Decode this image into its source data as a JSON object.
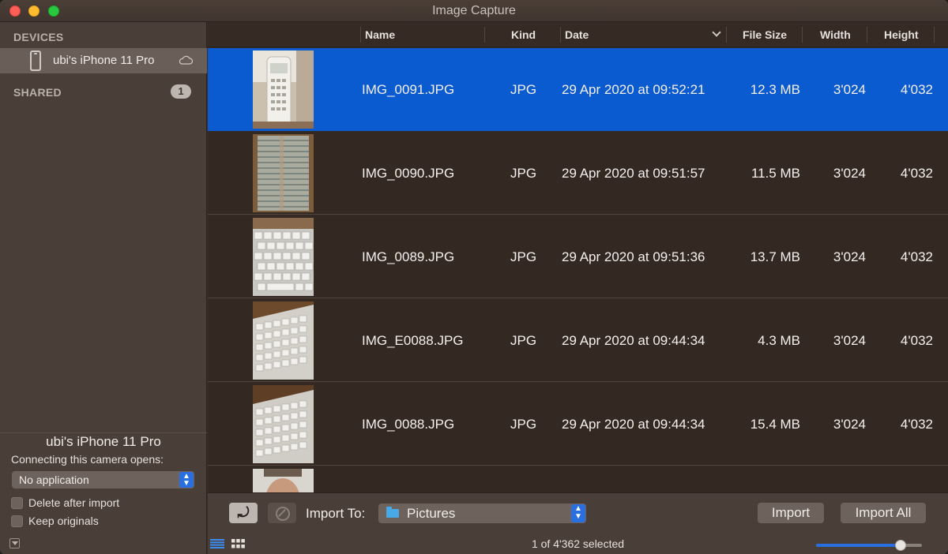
{
  "window": {
    "title": "Image Capture"
  },
  "sidebar": {
    "devices_label": "DEVICES",
    "device": {
      "name": "ubi's iPhone 11 Pro",
      "icon": "phone-icon",
      "status_icon": "cloud-icon"
    },
    "shared_label": "SHARED",
    "shared_count": "1",
    "device_info": {
      "title": "ubi's iPhone 11 Pro",
      "opens_label": "Connecting this camera opens:",
      "opens_value": "No application",
      "delete_after_import": {
        "label": "Delete after import",
        "checked": false
      },
      "keep_originals": {
        "label": "Keep originals",
        "checked": false
      }
    }
  },
  "table": {
    "columns": {
      "name": "Name",
      "kind": "Kind",
      "date": "Date",
      "size": "File Size",
      "width": "Width",
      "height": "Height"
    },
    "sort_column": "Date",
    "rows": [
      {
        "name": "IMG_0091.JPG",
        "kind": "JPG",
        "date": "29 Apr 2020 at 09:52:21",
        "size": "12.3 MB",
        "width": "3'024",
        "height": "4'032",
        "selected": true,
        "thumb": "cordless-phone"
      },
      {
        "name": "IMG_0090.JPG",
        "kind": "JPG",
        "date": "29 Apr 2020 at 09:51:57",
        "size": "11.5 MB",
        "width": "3'024",
        "height": "4'032",
        "selected": false,
        "thumb": "window-blinds"
      },
      {
        "name": "IMG_0089.JPG",
        "kind": "JPG",
        "date": "29 Apr 2020 at 09:51:36",
        "size": "13.7 MB",
        "width": "3'024",
        "height": "4'032",
        "selected": false,
        "thumb": "keyboard"
      },
      {
        "name": "IMG_E0088.JPG",
        "kind": "JPG",
        "date": "29 Apr 2020 at 09:44:34",
        "size": "4.3 MB",
        "width": "3'024",
        "height": "4'032",
        "selected": false,
        "thumb": "keyboard-angled"
      },
      {
        "name": "IMG_0088.JPG",
        "kind": "JPG",
        "date": "29 Apr 2020 at 09:44:34",
        "size": "15.4 MB",
        "width": "3'024",
        "height": "4'032",
        "selected": false,
        "thumb": "keyboard-angled"
      }
    ]
  },
  "bottom": {
    "import_to_label": "Import To:",
    "destination": "Pictures",
    "import_label": "Import",
    "import_all_label": "Import All",
    "status": "1 of 4'362 selected",
    "thumbnail_zoom": 0.8
  },
  "colors": {
    "selection": "#0a5ad0",
    "accent": "#2a6fe0"
  }
}
